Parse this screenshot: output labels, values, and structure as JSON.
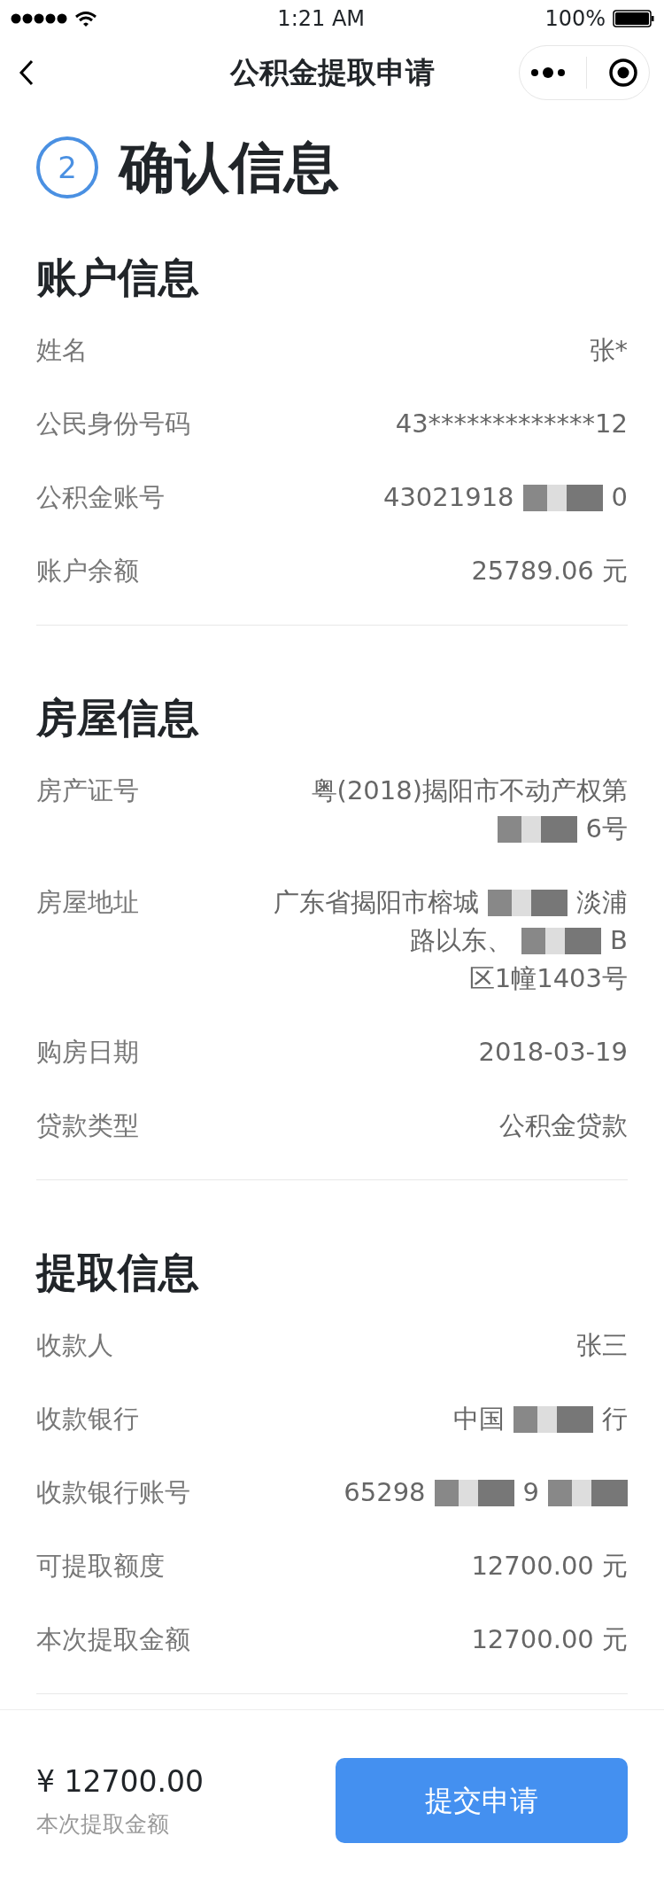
{
  "status_bar": {
    "time": "1:21 AM",
    "battery": "100%"
  },
  "nav": {
    "title": "公积金提取申请"
  },
  "step": {
    "number": "2",
    "title": "确认信息"
  },
  "sections": [
    {
      "title": "账户信息",
      "rows": [
        {
          "label": "姓名",
          "lines": [
            [
              {
                "kind": "text",
                "text": "张*"
              }
            ]
          ]
        },
        {
          "label": "公民身份号码",
          "lines": [
            [
              {
                "kind": "text",
                "text": "43*************12"
              }
            ]
          ]
        },
        {
          "label": "公积金账号",
          "lines": [
            [
              {
                "kind": "text",
                "text": "43021918"
              },
              {
                "kind": "redacted"
              },
              {
                "kind": "text",
                "text": "0"
              }
            ]
          ]
        },
        {
          "label": "账户余额",
          "lines": [
            [
              {
                "kind": "text",
                "text": "25789.06 元"
              }
            ]
          ]
        }
      ]
    },
    {
      "title": "房屋信息",
      "rows": [
        {
          "label": "房产证号",
          "lines": [
            [
              {
                "kind": "text",
                "text": "粤(2018)揭阳市不动产权第"
              }
            ],
            [
              {
                "kind": "redacted"
              },
              {
                "kind": "text",
                "text": "6号"
              }
            ]
          ]
        },
        {
          "label": "房屋地址",
          "lines": [
            [
              {
                "kind": "text",
                "text": "广东省揭阳市榕城"
              },
              {
                "kind": "redacted"
              },
              {
                "kind": "text",
                "text": "淡浦"
              }
            ],
            [
              {
                "kind": "text",
                "text": "路以东、"
              },
              {
                "kind": "redacted"
              },
              {
                "kind": "text",
                "text": "B"
              }
            ],
            [
              {
                "kind": "text",
                "text": "区1幢1403号"
              }
            ]
          ]
        },
        {
          "label": "购房日期",
          "lines": [
            [
              {
                "kind": "text",
                "text": "2018-03-19"
              }
            ]
          ]
        },
        {
          "label": "贷款类型",
          "lines": [
            [
              {
                "kind": "text",
                "text": "公积金贷款"
              }
            ]
          ]
        }
      ]
    },
    {
      "title": "提取信息",
      "rows": [
        {
          "label": "收款人",
          "lines": [
            [
              {
                "kind": "text",
                "text": "张三"
              }
            ]
          ]
        },
        {
          "label": "收款银行",
          "lines": [
            [
              {
                "kind": "text",
                "text": "中国"
              },
              {
                "kind": "redacted"
              },
              {
                "kind": "text",
                "text": "行"
              }
            ]
          ]
        },
        {
          "label": "收款银行账号",
          "lines": [
            [
              {
                "kind": "text",
                "text": "65298"
              },
              {
                "kind": "redacted"
              },
              {
                "kind": "text",
                "text": "9"
              },
              {
                "kind": "redacted"
              }
            ]
          ]
        },
        {
          "label": "可提取额度",
          "lines": [
            [
              {
                "kind": "text",
                "text": "12700.00 元"
              }
            ]
          ]
        },
        {
          "label": "本次提取金额",
          "lines": [
            [
              {
                "kind": "text",
                "text": "12700.00 元"
              }
            ]
          ]
        }
      ]
    }
  ],
  "footer": {
    "amount": "¥ 12700.00",
    "caption": "本次提取金额",
    "button": "提交申请"
  }
}
